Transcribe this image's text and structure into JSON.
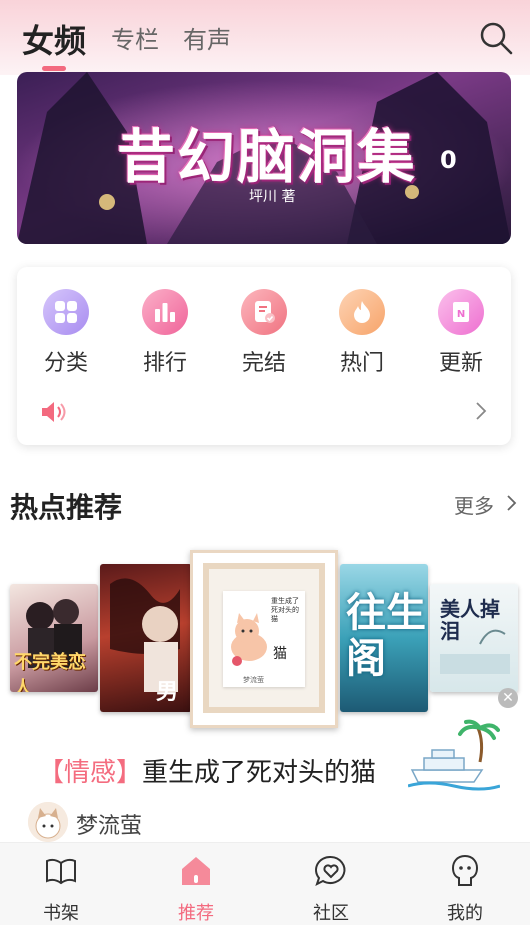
{
  "header": {
    "tabs": [
      {
        "label": "女频",
        "active": true
      },
      {
        "label": "专栏",
        "active": false
      },
      {
        "label": "有声",
        "active": false
      }
    ],
    "search_icon": "search-icon"
  },
  "banner": {
    "title": "昔幻脑洞集",
    "suffix": "0",
    "author": "坪川 著"
  },
  "quick_nav": {
    "items": [
      {
        "label": "分类",
        "icon": "grid-icon",
        "color": "#b59af5"
      },
      {
        "label": "排行",
        "icon": "bar-chart-icon",
        "color": "#f57ba4"
      },
      {
        "label": "完结",
        "icon": "doc-check-icon",
        "color": "#f48a94"
      },
      {
        "label": "热门",
        "icon": "flame-icon",
        "color": "#f9b27f"
      },
      {
        "label": "更新",
        "icon": "book-n-icon",
        "color": "#f589d6"
      }
    ],
    "announcement_icon": "speaker-icon"
  },
  "section": {
    "title": "热点推荐",
    "more_label": "更多"
  },
  "books": [
    {
      "cover_text": "不完美恋人"
    },
    {
      "cover_text": "男"
    },
    {
      "cover_text": "猫",
      "cover_title": "重生成了死对头的猫",
      "cover_author": "梦流萤"
    },
    {
      "cover_text": "往生阁"
    },
    {
      "cover_text": "美人掉泪"
    }
  ],
  "featured": {
    "genre": "【情感】",
    "title": "重生成了死对头的猫",
    "author": "梦流萤"
  },
  "bottom_nav": {
    "items": [
      {
        "label": "书架",
        "active": false
      },
      {
        "label": "推荐",
        "active": true
      },
      {
        "label": "社区",
        "active": false
      },
      {
        "label": "我的",
        "active": false
      }
    ]
  },
  "colors": {
    "accent": "#f36a7f",
    "header_bg": "#f9d3d9"
  }
}
